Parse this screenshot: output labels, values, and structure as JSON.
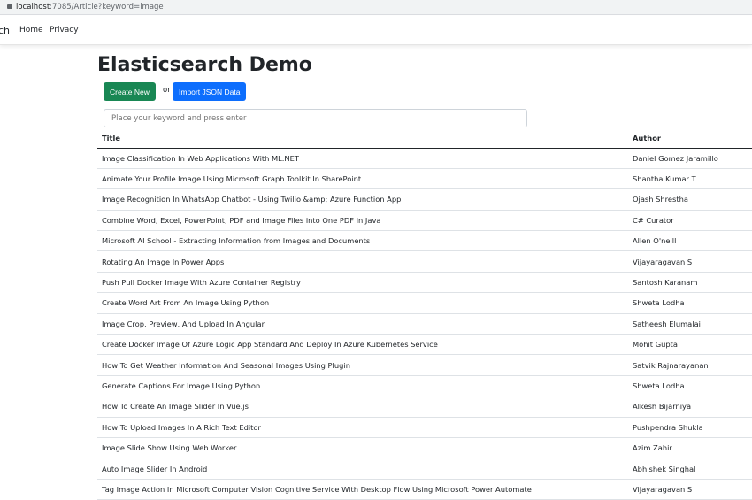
{
  "browser": {
    "url_host": "localhost",
    "url_rest": ":7085/Article?keyword=image"
  },
  "nav": {
    "brand": "ch",
    "items": [
      "Home",
      "Privacy"
    ]
  },
  "page": {
    "title": "Elasticsearch Demo",
    "create_label": "Create New",
    "or_text": "or",
    "import_label": "Import JSON Data",
    "search_placeholder": "Place your keyword and press enter",
    "create_color": "#198754",
    "import_color": "#0d6efd"
  },
  "table": {
    "headers": [
      "Title",
      "Author"
    ],
    "rows": [
      [
        "Image Classification In Web Applications With ML.NET",
        "Daniel Gomez Jaramillo"
      ],
      [
        "Animate Your Profile Image Using Microsoft Graph Toolkit In SharePoint",
        "Shantha Kumar T"
      ],
      [
        "Image Recognition In WhatsApp Chatbot - Using Twilio &amp; Azure Function App",
        "Ojash Shrestha"
      ],
      [
        "Combine Word, Excel, PowerPoint, PDF and Image Files into One PDF in Java",
        "C# Curator"
      ],
      [
        "Microsoft AI School - Extracting Information from Images and Documents",
        "Allen O'neill"
      ],
      [
        "Rotating An Image In Power Apps",
        "Vijayaragavan S"
      ],
      [
        "Push Pull Docker Image With Azure Container Registry",
        "Santosh Karanam"
      ],
      [
        "Create Word Art From An Image Using Python",
        "Shweta Lodha"
      ],
      [
        "Image Crop, Preview, And Upload In Angular",
        "Satheesh Elumalai"
      ],
      [
        "Create Docker Image Of Azure Logic App Standard And Deploy In Azure Kubernetes Service",
        "Mohit Gupta"
      ],
      [
        "How To Get Weather Information And Seasonal Images Using Plugin",
        "Satvik Rajnarayanan"
      ],
      [
        "Generate Captions For Image Using Python",
        "Shweta Lodha"
      ],
      [
        "How To Create An Image Slider In Vue.js",
        "Alkesh Bijarniya"
      ],
      [
        "How To Upload Images In A Rich Text Editor",
        "Pushpendra Shukla"
      ],
      [
        "Image Slide Show Using Web Worker",
        "Azim Zahir"
      ],
      [
        "Auto Image Slider In Android",
        "Abhishek Singhal"
      ],
      [
        "Tag Image Action In Microsoft Computer Vision Cognitive Service With Desktop Flow Using Microsoft Power Automate",
        "Vijayaragavan S"
      ]
    ]
  }
}
